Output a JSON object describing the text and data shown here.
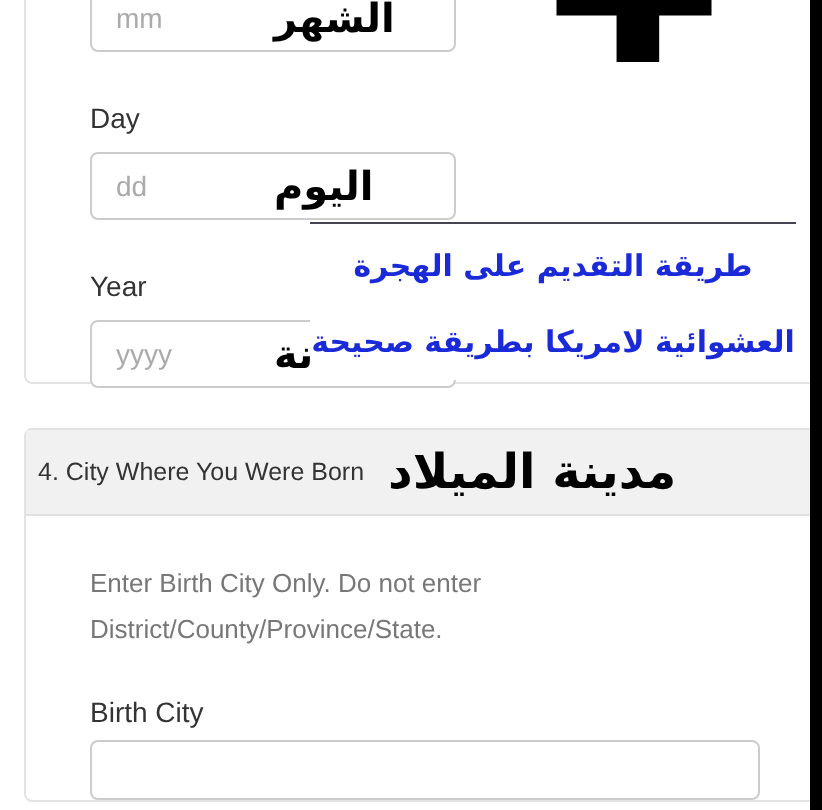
{
  "date_fields": [
    {
      "placeholder": "mm",
      "overlay": "الشهر"
    },
    {
      "label": "Day",
      "placeholder": "dd",
      "overlay": "اليوم"
    },
    {
      "label": "Year",
      "placeholder": "yyyy",
      "overlay": "نة"
    }
  ],
  "banner": {
    "lines": [
      "طريقة التقديم على الهجرة",
      "العشوائية لامريكا بطريقة صحيحة"
    ]
  },
  "section": {
    "title": "4. City Where You Were Born",
    "overlay": "مدينة الميلاد",
    "hint": "Enter Birth City Only. Do not enter District/County/Province/State.",
    "field_label": "Birth City"
  }
}
